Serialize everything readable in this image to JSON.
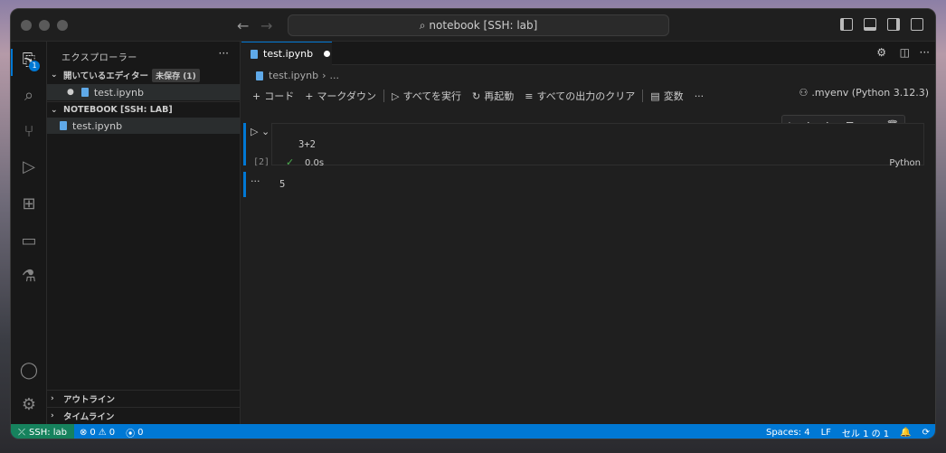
{
  "titlebar": {
    "search_text": "notebook [SSH: lab]"
  },
  "activity": {
    "explorer_badge": "1"
  },
  "sidebar": {
    "title": "エクスプローラー",
    "more": "···",
    "open_editors": {
      "label": "開いているエディター",
      "unsaved": "未保存 (1)",
      "file": "test.ipynb"
    },
    "folder": {
      "label": "NOTEBOOK [SSH: LAB]",
      "file": "test.ipynb"
    },
    "outline": "アウトライン",
    "timeline": "タイムライン"
  },
  "editor": {
    "tab_label": "test.ipynb",
    "breadcrumb": [
      "test.ipynb",
      "..."
    ],
    "toolbar": {
      "add_code": "コード",
      "add_markdown": "マークダウン",
      "run_all": "すべてを実行",
      "restart": "再起動",
      "clear_outputs": "すべての出力のクリア",
      "variables": "変数",
      "more": "···",
      "kernel": ".myenv (Python 3.12.3)"
    },
    "cell": {
      "exec_count": "[2]",
      "code": "3+2",
      "duration": "0.0s",
      "language": "Python",
      "output": "5",
      "output_more": "···"
    }
  },
  "statusbar": {
    "remote": "SSH: lab",
    "errors": "0",
    "warnings": "0",
    "ports": "0",
    "spaces": "Spaces: 4",
    "eol": "LF",
    "cell_pos": "セル 1 の 1"
  },
  "colors": {
    "accent": "#0078d4",
    "remote": "#16825d",
    "success": "#4caf50"
  }
}
